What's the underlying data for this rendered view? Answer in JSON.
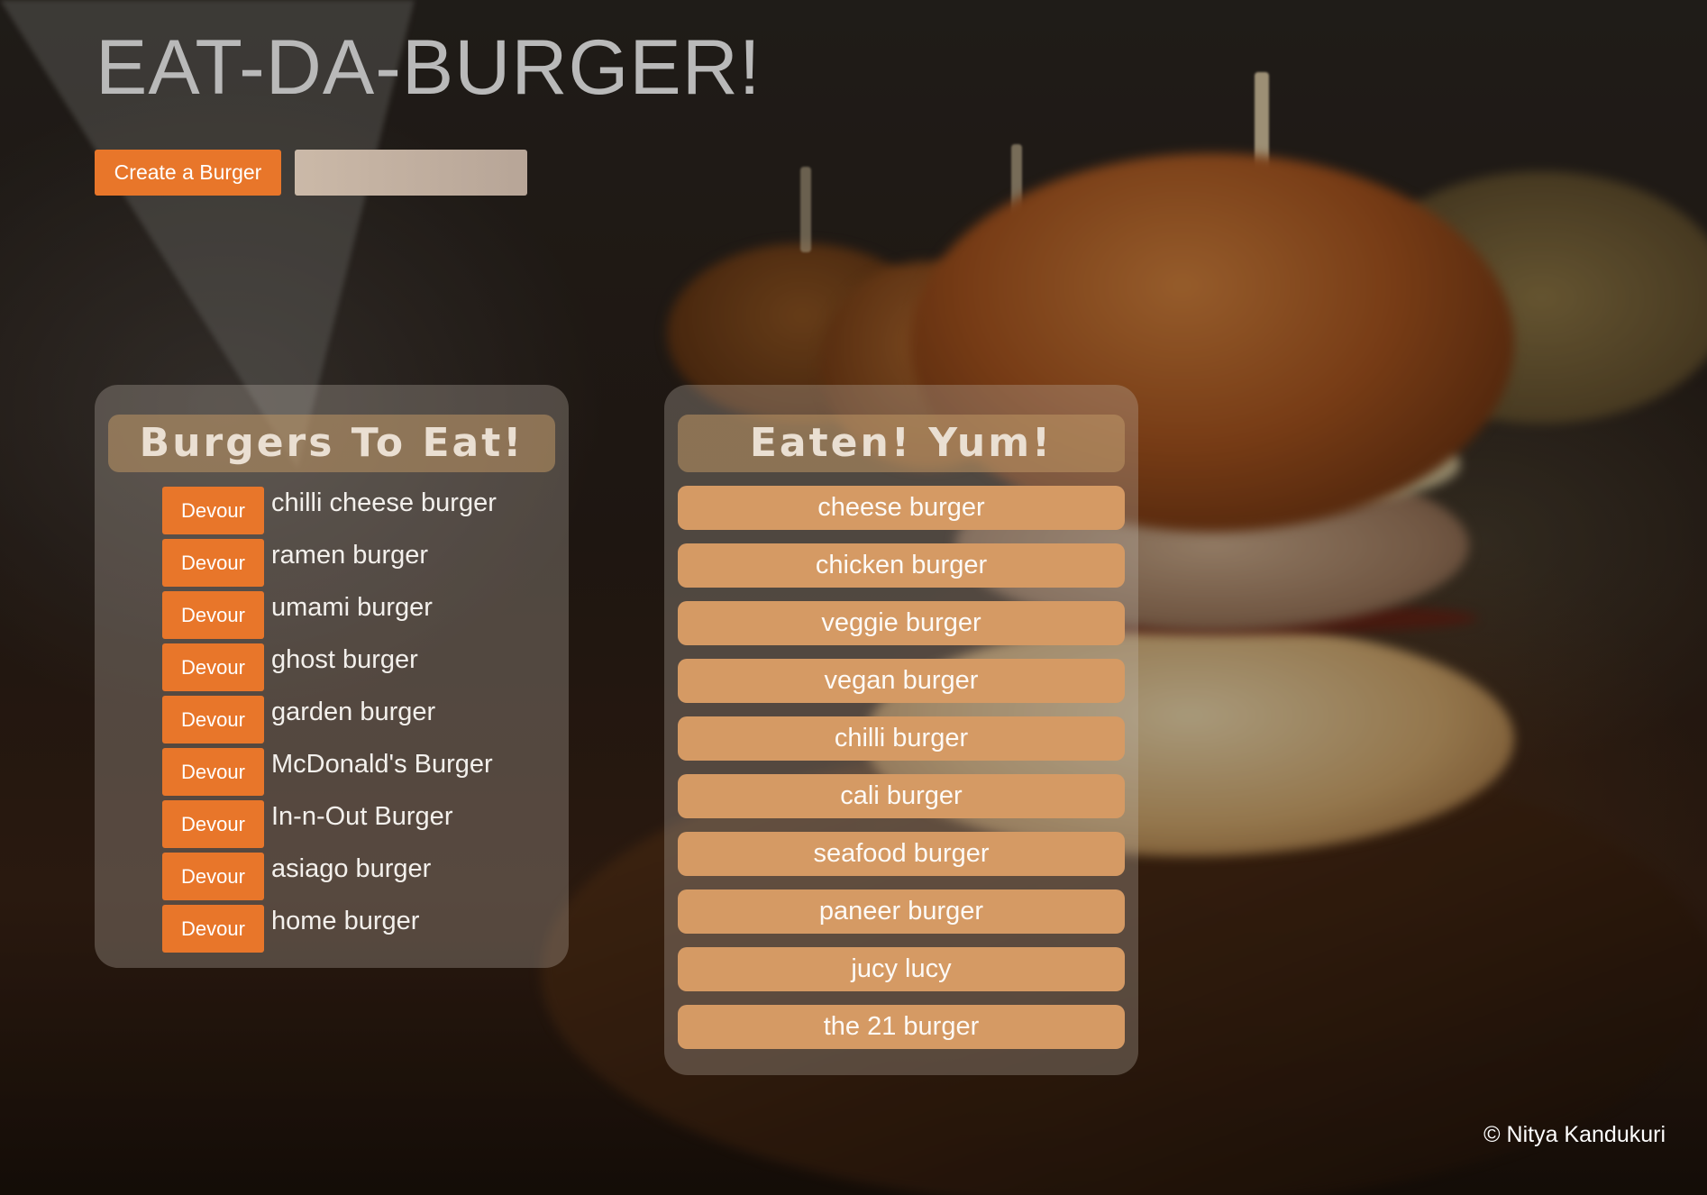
{
  "header": {
    "title": "EAT-DA-BURGER!"
  },
  "form": {
    "create_label": "Create a Burger",
    "input_value": "",
    "input_placeholder": ""
  },
  "to_eat": {
    "heading": "Burgers To Eat!",
    "devour_label": "Devour",
    "items": [
      "chilli cheese burger",
      "ramen burger",
      "umami burger",
      "ghost burger",
      "garden burger",
      "McDonald's Burger",
      "In-n-Out Burger",
      "asiago burger",
      "home burger"
    ]
  },
  "eaten": {
    "heading": "Eaten! Yum!",
    "items": [
      "cheese burger",
      "chicken burger",
      "veggie burger",
      "vegan burger",
      "chilli burger",
      "cali burger",
      "seafood burger",
      "paneer burger",
      "jucy lucy",
      "the 21 burger"
    ]
  },
  "footer": {
    "text": "© Nitya Kandukuri"
  },
  "colors": {
    "accent": "#e8762a",
    "eaten_item": "#d59a64",
    "title": "#b9b9b9"
  }
}
